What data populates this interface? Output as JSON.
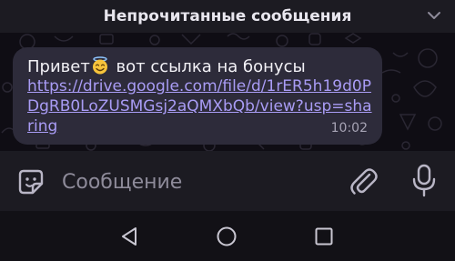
{
  "header": {
    "title": "Непрочитанные сообщения",
    "chevron_icon": "chevron-down-icon"
  },
  "message": {
    "text_before_emoji": "Привет",
    "emoji": "smiling-face-with-halo",
    "text_after_emoji": " вот ссылка на бонусы",
    "link": "https://drive.google.com/file/d/1rER5h19d0PDgRB0LoZUSMGsj2aQMXbQb/view?usp=sharing",
    "time": "10:02"
  },
  "input": {
    "placeholder": "Сообщение",
    "value": ""
  },
  "icons": {
    "sticker": "sticker-icon",
    "attach": "paperclip-icon",
    "mic": "microphone-icon"
  },
  "nav": {
    "back": "back-triangle-icon",
    "home": "home-circle-icon",
    "recents": "recents-square-icon"
  },
  "colors": {
    "header_bg": "#1c1b22",
    "bubble_bg": "#2d2b3a",
    "link": "#a99cf5",
    "chat_bg": "#0f0d14"
  }
}
